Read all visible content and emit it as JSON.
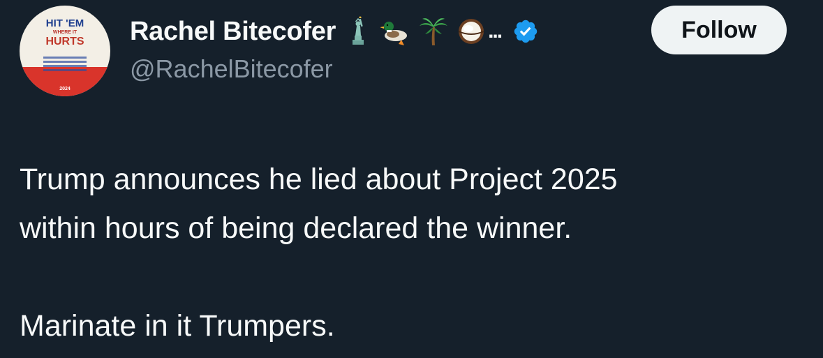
{
  "author": {
    "display_name": "Rachel Bitecofer",
    "name_emojis": [
      "statue-of-liberty",
      "duck",
      "palm-tree",
      "coconut"
    ],
    "name_truncation": "...",
    "verified": true,
    "handle": "@RachelBitecofer",
    "avatar": {
      "line1": "HIT 'EM",
      "line2": "WHERE IT",
      "line3": "HURTS",
      "year": "2024"
    }
  },
  "actions": {
    "follow_label": "Follow"
  },
  "tweet": {
    "line1": "Trump announces he lied about Project 2025",
    "line2": "within hours of being declared the winner.",
    "line3": "Marinate in it Trumpers."
  },
  "colors": {
    "background": "#15202b",
    "text_primary": "#f7f9f9",
    "text_secondary": "#8b98a5",
    "verified_blue": "#1d9bf0",
    "follow_bg": "#eff3f4"
  }
}
